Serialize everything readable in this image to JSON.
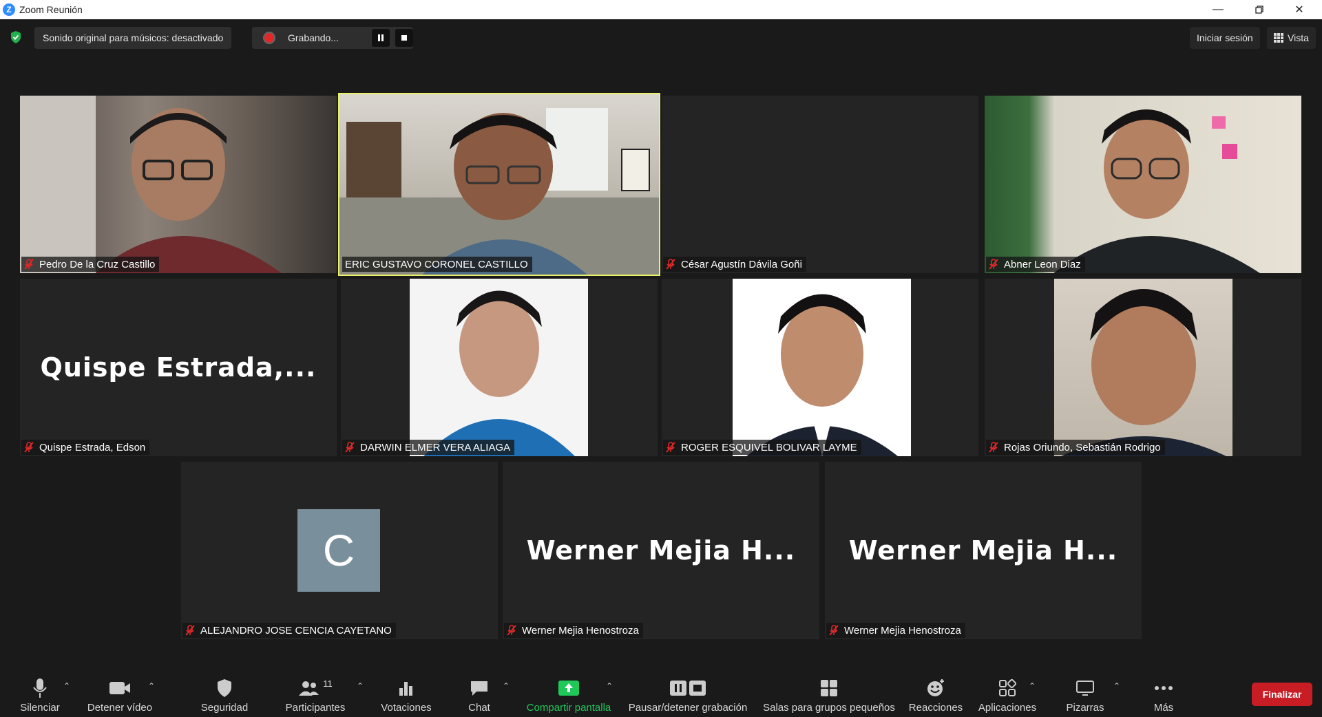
{
  "window": {
    "title": "Zoom Reunión",
    "logo_letter": "Z"
  },
  "topbar": {
    "original_sound": "Sonido original para músicos: desactivado",
    "recording_label": "Grabando...",
    "sign_in": "Iniciar sesión",
    "view": "Vista"
  },
  "participants": [
    {
      "name": "Pedro De la Cruz Castillo",
      "muted": true,
      "video": true
    },
    {
      "name": "ERIC GUSTAVO CORONEL CASTILLO",
      "muted": false,
      "video": true,
      "active_speaker": true
    },
    {
      "name": "César Agustín Dávila Goñi",
      "muted": true,
      "video": false
    },
    {
      "name": "Abner Leon Diaz",
      "muted": true,
      "video": true
    },
    {
      "name": "Quispe Estrada, Edson",
      "display_name": "Quispe  Estrada,...",
      "muted": true,
      "video": false
    },
    {
      "name": "DARWIN ELMER VERA ALIAGA",
      "muted": true,
      "video": true
    },
    {
      "name": "ROGER ESQUIVEL BOLIVAR LAYME",
      "muted": true,
      "video": true
    },
    {
      "name": "Rojas Oriundo, Sebastián Rodrigo",
      "muted": true,
      "video": true
    },
    {
      "name": "ALEJANDRO JOSE CENCIA CAYETANO",
      "avatar_letter": "C",
      "muted": true,
      "video": false
    },
    {
      "name": "Werner Mejia Henostroza",
      "display_name": "Werner  Mejia  H...",
      "muted": true,
      "video": false
    },
    {
      "name": "Werner Mejia Henostroza",
      "display_name": "Werner  Mejia  H...",
      "muted": true,
      "video": false
    }
  ],
  "toolbar": {
    "mute": "Silenciar",
    "stop_video": "Detener vídeo",
    "security": "Seguridad",
    "participants": "Participantes",
    "participants_count": "11",
    "polls": "Votaciones",
    "chat": "Chat",
    "share_screen": "Compartir pantalla",
    "pause_recording": "Pausar/detener grabación",
    "breakout_rooms": "Salas para grupos pequeños",
    "reactions": "Reacciones",
    "apps": "Aplicaciones",
    "whiteboards": "Pizarras",
    "more": "Más",
    "end": "Finalizar"
  },
  "colors": {
    "active_speaker": "#e9f06a",
    "end_button": "#c81d25",
    "share_green": "#1ec95a",
    "muted_red": "#e02828"
  }
}
